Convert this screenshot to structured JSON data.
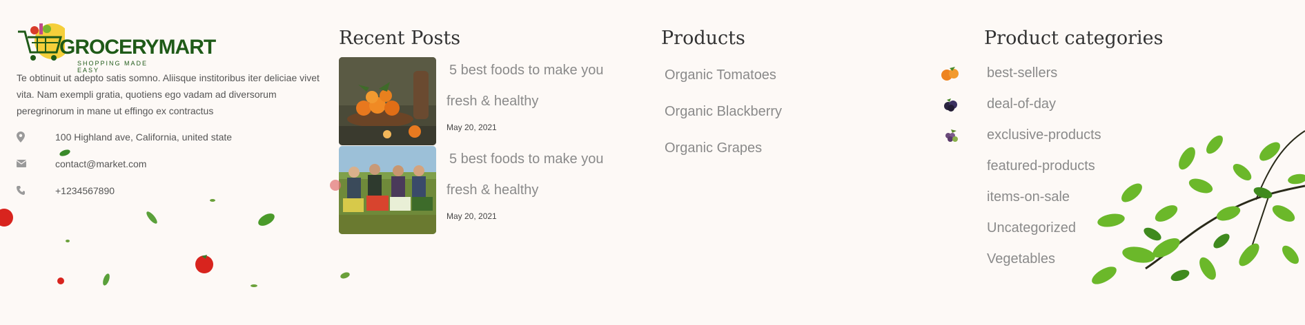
{
  "brand": {
    "name": "GROCERYMART",
    "tagline": "SHOPPING MADE EASY"
  },
  "about": {
    "text": "Te obtinuit ut adepto satis somno. Aliisque institoribus iter deliciae vivet vita. Nam exempli gratia, quotiens ego vadam ad diversorum peregrinorum in mane ut effingo ex contractus"
  },
  "contact": {
    "address": "100 Highland ave, California, united state",
    "email": "contact@market.com",
    "phone": "+1234567890"
  },
  "recent_posts": {
    "heading": "Recent Posts",
    "items": [
      {
        "title_line1": "5 best foods to make you",
        "title_line2": "fresh & healthy",
        "date": "May 20, 2021"
      },
      {
        "title_line1": "5 best foods to make you",
        "title_line2": "fresh & healthy",
        "date": "May 20, 2021"
      }
    ]
  },
  "products": {
    "heading": "Products",
    "items": [
      "Organic Tomatoes",
      "Organic Blackberry",
      "Organic Grapes"
    ]
  },
  "categories": {
    "heading": "Product categories",
    "items": [
      "best-sellers",
      "deal-of-day",
      "exclusive-products",
      "featured-products",
      "items-on-sale",
      "Uncategorized",
      "Vegetables"
    ]
  },
  "colors": {
    "background": "#fdf9f6",
    "brand_green": "#1f5a18",
    "brand_yellow": "#f5cf3a",
    "muted_text": "#8a8a8a"
  },
  "icons": [
    "map-pin-icon",
    "envelope-icon",
    "phone-icon"
  ]
}
